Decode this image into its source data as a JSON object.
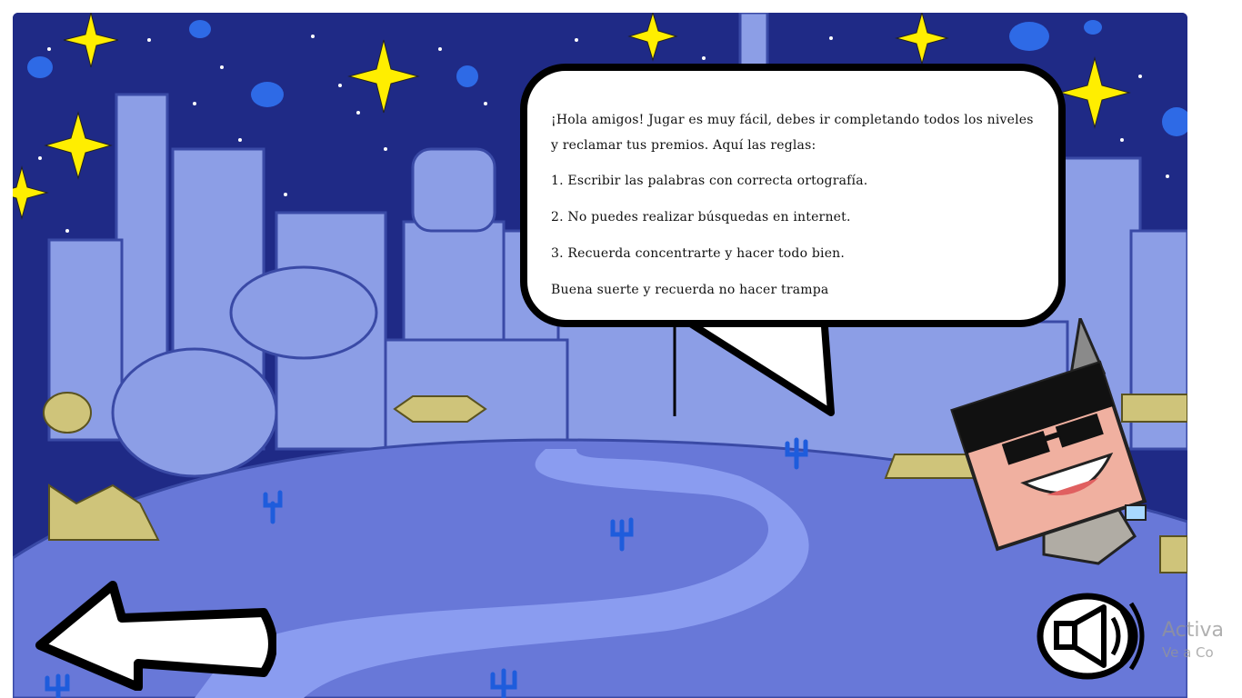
{
  "speech_bubble": {
    "intro": "¡Hola amigos! Jugar es muy fácil, debes ir completando todos los niveles y reclamar tus premios. Aquí las reglas:",
    "rule_1": "1. Escribir las palabras con correcta ortografía.",
    "rule_2": "2. No puedes realizar búsquedas en internet.",
    "rule_3": "3. Recuerda concentrarte y hacer todo bien.",
    "farewell": "Buena suerte y recuerda no hacer trampa"
  },
  "controls": {
    "back_icon": "left-arrow-icon",
    "sound_icon": "speaker-icon"
  },
  "watermark": {
    "line1": "Activa",
    "line2": "Ve a Co"
  },
  "colors": {
    "sky": "#1f2a86",
    "buildings": "#8c9ee6",
    "ground": "#6878d8",
    "path": "#8a9cf0",
    "stars": "#ffee00"
  }
}
